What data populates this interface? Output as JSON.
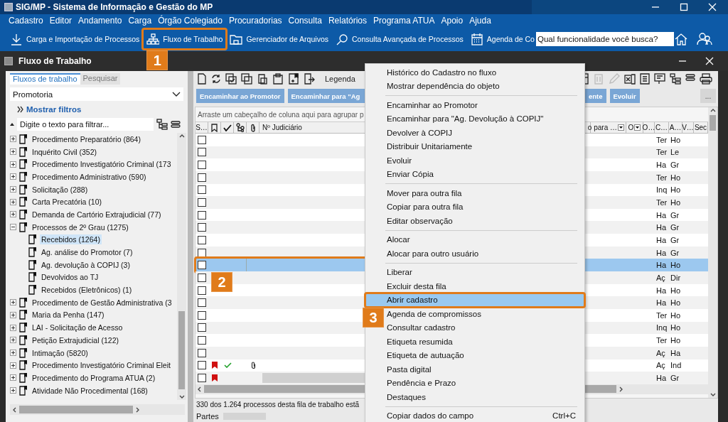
{
  "window": {
    "title": "SIG/MP - Sistema de Informação e Gestão do MP"
  },
  "menu": [
    "Cadastro",
    "Editor",
    "Andamento",
    "Carga",
    "Órgão Colegiado",
    "Procuradorias",
    "Consulta",
    "Relatórios",
    "Programa ATUA",
    "Apoio",
    "Ajuda"
  ],
  "toolbar": {
    "items": [
      {
        "label": "Carga e Importação de Processos",
        "kind": "download"
      },
      {
        "label": "Fluxo de Trabalho",
        "kind": "flow",
        "callout": "1"
      },
      {
        "label": "Gerenciador de Arquivos",
        "kind": "folder"
      },
      {
        "label": "Consulta Avançada de Processos",
        "kind": "search"
      },
      {
        "label": "Agenda de Co",
        "kind": "calendar"
      }
    ],
    "search": {
      "placeholder": "Qual funcionalidade você busca?"
    }
  },
  "panel": {
    "title": "Fluxo de Trabalho"
  },
  "sidebar": {
    "tabs": [
      {
        "label": "Fluxos de trabalho",
        "selected": true
      },
      {
        "label": "Pesquisar",
        "selected": false
      }
    ],
    "dropdown": {
      "value": "Promotoria"
    },
    "filters_link": "Mostrar filtros",
    "filter": {
      "placeholder": "Digite o texto para filtrar..."
    },
    "tree": [
      {
        "label": "Procedimento Preparatório (864)",
        "expanded": false
      },
      {
        "label": "Inquérito Civil (352)",
        "expanded": false
      },
      {
        "label": "Procedimento Investigatório Criminal (173",
        "expanded": false
      },
      {
        "label": "Procedimento Administrativo (590)",
        "expanded": false
      },
      {
        "label": "Solicitação (288)",
        "expanded": false
      },
      {
        "label": "Carta Precatória (10)",
        "expanded": false
      },
      {
        "label": "Demanda de Cartório Extrajudicial (77)",
        "expanded": false
      },
      {
        "label": "Processos de 2º Grau (1275)",
        "expanded": true,
        "children": [
          {
            "label": "Recebidos (1264)",
            "selected": true
          },
          {
            "label": "Ag. análise do Promotor (7)",
            "selected": false
          },
          {
            "label": "Ag. devolução à COPIJ (3)",
            "selected": false
          },
          {
            "label": "Devolvidos ao TJ",
            "selected": false
          },
          {
            "label": "Recebidos (Eletrônicos) (1)",
            "selected": false
          }
        ]
      },
      {
        "label": "Procedimento de Gestão Administrativa (3",
        "expanded": false
      },
      {
        "label": "Maria da Penha (147)",
        "expanded": false
      },
      {
        "label": "LAI - Solicitação de Acesso",
        "expanded": false
      },
      {
        "label": "Petição Extrajudicial (122)",
        "expanded": false
      },
      {
        "label": "Intimação (5820)",
        "expanded": false
      },
      {
        "label": "Procedimento Investigatório Criminal Eleit",
        "expanded": false
      },
      {
        "label": "Procedimento do Programa ATUA (2)",
        "expanded": false
      },
      {
        "label": "Atividade Não Procedimental (168)",
        "expanded": false
      }
    ]
  },
  "grid": {
    "toolbar_label": "Legenda",
    "actions": [
      "Encaminhar ao Promotor",
      "Encaminhar para \"Ag",
      "ente",
      "Evoluir"
    ],
    "more": "...",
    "group_hint": "Arraste um cabeçalho de coluna aqui para agrupar p",
    "first_column": "S…",
    "judicial_column": "Nº Judiciário",
    "right_columns": [
      {
        "label": "o para …",
        "filter": true
      },
      {
        "label": "O",
        "filter": true
      },
      {
        "label": "O…",
        "filter": false
      },
      {
        "label": "C…",
        "filter": false
      },
      {
        "label": "A…",
        "filter": false
      },
      {
        "label": "V…",
        "filter": false
      },
      {
        "label": "Sec",
        "filter": false
      }
    ],
    "rows": [
      {
        "selected": false,
        "checked": false,
        "bookmarked": false,
        "done": false,
        "attachment": false,
        "redacted": false,
        "column_c": "Ter",
        "column_a": "Ho"
      },
      {
        "selected": false,
        "checked": false,
        "bookmarked": false,
        "done": false,
        "attachment": false,
        "redacted": false,
        "column_c": "Ter",
        "column_a": "Le"
      },
      {
        "selected": false,
        "checked": false,
        "bookmarked": false,
        "done": false,
        "attachment": false,
        "redacted": false,
        "column_c": "Ha",
        "column_a": "Gr"
      },
      {
        "selected": false,
        "checked": false,
        "bookmarked": false,
        "done": false,
        "attachment": false,
        "redacted": false,
        "column_c": "Ter",
        "column_a": "Ho"
      },
      {
        "selected": false,
        "checked": false,
        "bookmarked": false,
        "done": false,
        "attachment": false,
        "redacted": false,
        "column_c": "Inq",
        "column_a": "Ho"
      },
      {
        "selected": false,
        "checked": false,
        "bookmarked": false,
        "done": false,
        "attachment": false,
        "redacted": false,
        "column_c": "Ter",
        "column_a": "Ho"
      },
      {
        "selected": false,
        "checked": false,
        "bookmarked": false,
        "done": false,
        "attachment": false,
        "redacted": false,
        "column_c": "Ha",
        "column_a": "Gr"
      },
      {
        "selected": false,
        "checked": false,
        "bookmarked": false,
        "done": false,
        "attachment": false,
        "redacted": false,
        "column_c": "Ha",
        "column_a": "Gr"
      },
      {
        "selected": false,
        "checked": false,
        "bookmarked": false,
        "done": false,
        "attachment": false,
        "redacted": false,
        "column_c": "Ha",
        "column_a": "Gr"
      },
      {
        "selected": false,
        "checked": false,
        "bookmarked": false,
        "done": false,
        "attachment": false,
        "redacted": false,
        "column_c": "Ha",
        "column_a": "Gr"
      },
      {
        "selected": true,
        "checked": false,
        "bookmarked": false,
        "done": false,
        "attachment": false,
        "redacted": false,
        "column_c": "Ha",
        "column_a": "Ho",
        "callout": "2"
      },
      {
        "selected": false,
        "checked": false,
        "bookmarked": false,
        "done": false,
        "attachment": false,
        "redacted": false,
        "column_c": "Aç",
        "column_a": "Dir"
      },
      {
        "selected": false,
        "checked": false,
        "bookmarked": false,
        "done": false,
        "attachment": false,
        "redacted": false,
        "column_c": "Ha",
        "column_a": "Ho"
      },
      {
        "selected": false,
        "checked": false,
        "bookmarked": false,
        "done": false,
        "attachment": false,
        "redacted": false,
        "column_c": "Ha",
        "column_a": "Ho"
      },
      {
        "selected": false,
        "checked": false,
        "bookmarked": false,
        "done": false,
        "attachment": false,
        "redacted": false,
        "column_c": "Ter",
        "column_a": "Ho"
      },
      {
        "selected": false,
        "checked": false,
        "bookmarked": false,
        "done": false,
        "attachment": false,
        "redacted": false,
        "column_c": "Inq",
        "column_a": "Ho"
      },
      {
        "selected": false,
        "checked": false,
        "bookmarked": false,
        "done": false,
        "attachment": false,
        "redacted": false,
        "column_c": "Ter",
        "column_a": "Ho"
      },
      {
        "selected": false,
        "checked": false,
        "bookmarked": false,
        "done": false,
        "attachment": false,
        "redacted": false,
        "column_c": "Aç",
        "column_a": "Ha"
      },
      {
        "selected": false,
        "checked": false,
        "bookmarked": true,
        "done": true,
        "attachment": true,
        "redacted": false,
        "column_c": "Aç",
        "column_a": "Ind"
      },
      {
        "selected": false,
        "checked": false,
        "bookmarked": true,
        "done": false,
        "attachment": false,
        "redacted": true,
        "column_c": "Ha",
        "column_a": "Gr"
      }
    ],
    "status": "330 dos 1.264 processos desta fila de trabalho estã",
    "details_label": "Partes"
  },
  "context_menu": {
    "groups": [
      [
        {
          "label": "Histórico do Cadastro no fluxo",
          "selected": false
        },
        {
          "label": "Mostrar dependência do objeto",
          "selected": false
        }
      ],
      [
        {
          "label": "Encaminhar ao Promotor",
          "selected": false
        },
        {
          "label": "Encaminhar para \"Ag. Devolução à COPIJ\"",
          "selected": false
        },
        {
          "label": "Devolver à COPIJ",
          "selected": false
        },
        {
          "label": "Distribuir Unitariamente",
          "selected": false
        },
        {
          "label": "Evoluir",
          "selected": false
        },
        {
          "label": "Enviar Cópia",
          "selected": false
        }
      ],
      [
        {
          "label": "Mover para outra fila",
          "selected": false
        },
        {
          "label": "Copiar para outra fila",
          "selected": false
        },
        {
          "label": "Editar observação",
          "selected": false
        }
      ],
      [
        {
          "label": "Alocar",
          "selected": false
        },
        {
          "label": "Alocar para outro usuário",
          "selected": false
        }
      ],
      [
        {
          "label": "Liberar",
          "selected": false
        },
        {
          "label": "Excluir desta fila",
          "selected": false
        },
        {
          "label": "Abrir cadastro",
          "selected": true,
          "callout": "3"
        },
        {
          "label": "Agenda de compromissos",
          "selected": false
        },
        {
          "label": "Consultar cadastro",
          "selected": false
        },
        {
          "label": "Etiqueta resumida",
          "selected": false
        },
        {
          "label": "Etiqueta de autuação",
          "selected": false
        },
        {
          "label": "Pasta digital",
          "selected": false
        },
        {
          "label": "Pendência e Prazo",
          "selected": false
        },
        {
          "label": "Destaques",
          "selected": false
        }
      ],
      [
        {
          "label": "Copiar dados do campo",
          "selected": false,
          "shortcut": "Ctrl+C"
        }
      ]
    ]
  }
}
